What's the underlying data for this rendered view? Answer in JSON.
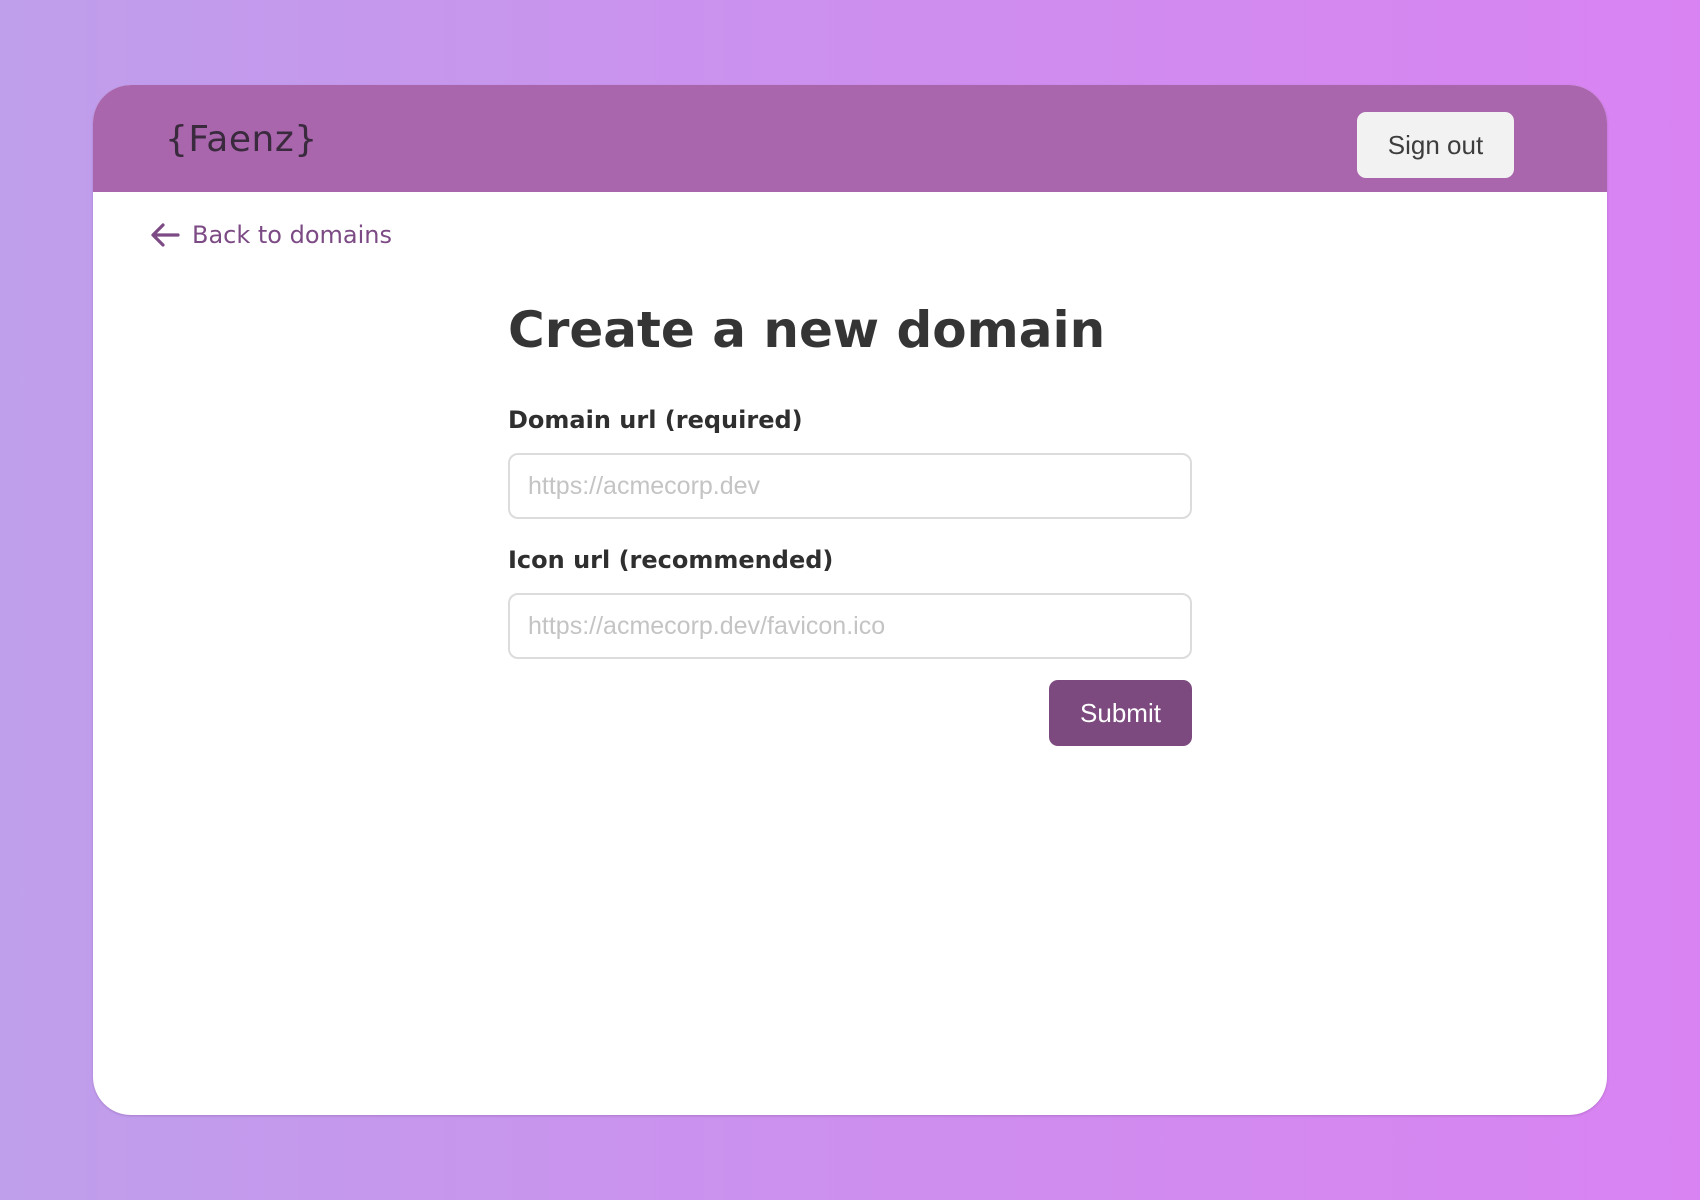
{
  "header": {
    "logo": "{Faenz}",
    "sign_out_label": "Sign out"
  },
  "nav": {
    "back_label": "Back to domains",
    "back_icon": "arrow-left-icon"
  },
  "form": {
    "title": "Create a new domain",
    "domain_url": {
      "label": "Domain url (required)",
      "placeholder": "https://acmecorp.dev",
      "value": ""
    },
    "icon_url": {
      "label": "Icon url (recommended)",
      "placeholder": "https://acmecorp.dev/favicon.ico",
      "value": ""
    },
    "submit_label": "Submit"
  },
  "colors": {
    "background_start": "#bf9fec",
    "background_end": "#d983f2",
    "header": "#aa66ad",
    "accent": "#7d4a80",
    "link": "#7c4a84"
  }
}
